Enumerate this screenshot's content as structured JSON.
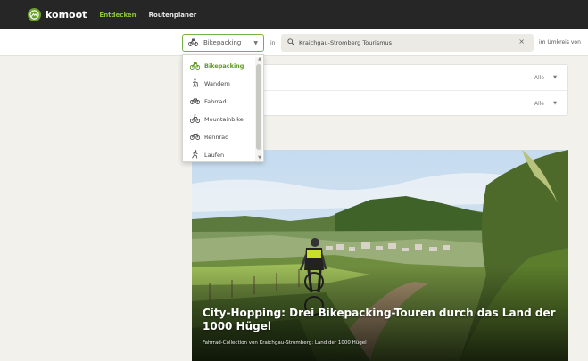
{
  "nav": {
    "logo_text": "komoot",
    "links": [
      {
        "label": "Entdecken",
        "active": true
      },
      {
        "label": "Routenplaner",
        "active": false
      }
    ]
  },
  "search": {
    "sport_value": "Bikepacking",
    "in_label": "in",
    "region_value": "Kraichgau-Stromberg Tourismus",
    "radius_label": "im Umkreis von"
  },
  "sport_dropdown": {
    "items": [
      {
        "label": "Bikepacking",
        "icon": "bikepacking-icon",
        "selected": true
      },
      {
        "label": "Wandern",
        "icon": "hiking-icon",
        "selected": false
      },
      {
        "label": "Fahrrad",
        "icon": "bicycle-icon",
        "selected": false
      },
      {
        "label": "Mountainbike",
        "icon": "mountainbike-icon",
        "selected": false
      },
      {
        "label": "Rennrad",
        "icon": "roadbike-icon",
        "selected": false
      },
      {
        "label": "Laufen",
        "icon": "running-icon",
        "selected": false
      }
    ]
  },
  "filters": [
    {
      "value": "Alle"
    },
    {
      "value": "Alle"
    }
  ],
  "collection": {
    "title": "City-Hopping: Drei Bikepacking-Touren durch das Land der 1000 Hügel",
    "subtitle": "Fahrrad-Collection von Kraichgau-Stromberg: Land der 1000 Hügel"
  },
  "colors": {
    "brand_green": "#6aa127",
    "nav_bg": "#262626",
    "active_link": "#8cc63f"
  }
}
